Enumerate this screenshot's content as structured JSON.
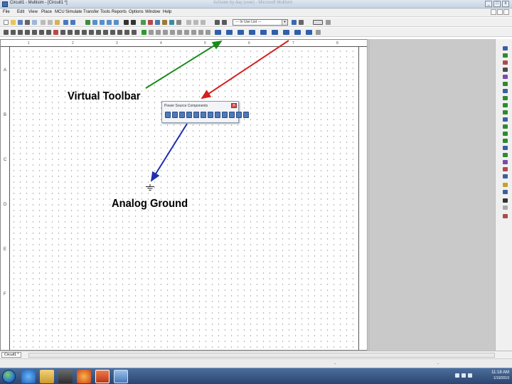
{
  "window": {
    "title": "Circuit1 - Multisim - [Circuit1 *]",
    "faded_title": "Activate by day (user)  - Microsoft Multisim",
    "controls": [
      "_",
      "□",
      "x"
    ]
  },
  "menu": [
    "File",
    "Edit",
    "View",
    "Place",
    "MCU",
    "Simulate",
    "Transfer",
    "Tools",
    "Reports",
    "Options",
    "Window",
    "Help"
  ],
  "toolbar": {
    "in_use_list": "--- In Use List ---",
    "combo_arrow": "▾"
  },
  "ruler": {
    "columns": [
      "1",
      "2",
      "3",
      "4",
      "5",
      "6",
      "7",
      "8"
    ],
    "rows": [
      "A",
      "B",
      "C",
      "D",
      "E",
      "F"
    ]
  },
  "annotations": {
    "virtual_toolbar": "Virtual Toolbar",
    "analog_ground": "Analog Ground"
  },
  "floating_toolbar": {
    "title": "Power Source Components",
    "close": "x",
    "icon_count": 12
  },
  "bottom": {
    "sheet_tab": "Circuit1 *",
    "status_dashes": [
      "-",
      "-"
    ]
  },
  "taskbar": {
    "apps": [
      "internet-explorer",
      "file-explorer",
      "media-player",
      "firefox",
      "powerpoint",
      "multisim"
    ],
    "time": "11:18 AM",
    "date": "1/19/2019"
  },
  "colors": {
    "green_arrow": "#1a8a1a",
    "red_arrow": "#d42020",
    "blue_arrow": "#1f2fb0",
    "canvas_grey": "#c9c9c9"
  }
}
